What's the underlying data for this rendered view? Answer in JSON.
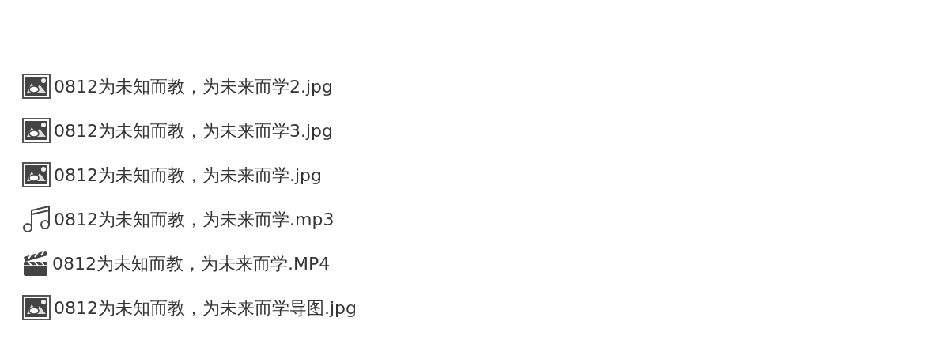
{
  "files": [
    {
      "kind": "image",
      "name": "0812为未知而教，为未来而学2.jpg"
    },
    {
      "kind": "image",
      "name": "0812为未知而教，为未来而学3.jpg"
    },
    {
      "kind": "image",
      "name": "0812为未知而教，为未来而学.jpg"
    },
    {
      "kind": "audio",
      "name": "0812为未知而教，为未来而学.mp3"
    },
    {
      "kind": "video",
      "name": "0812为未知而教，为未来而学.MP4"
    },
    {
      "kind": "image",
      "name": "0812为未知而教，为未来而学导图.jpg"
    }
  ]
}
